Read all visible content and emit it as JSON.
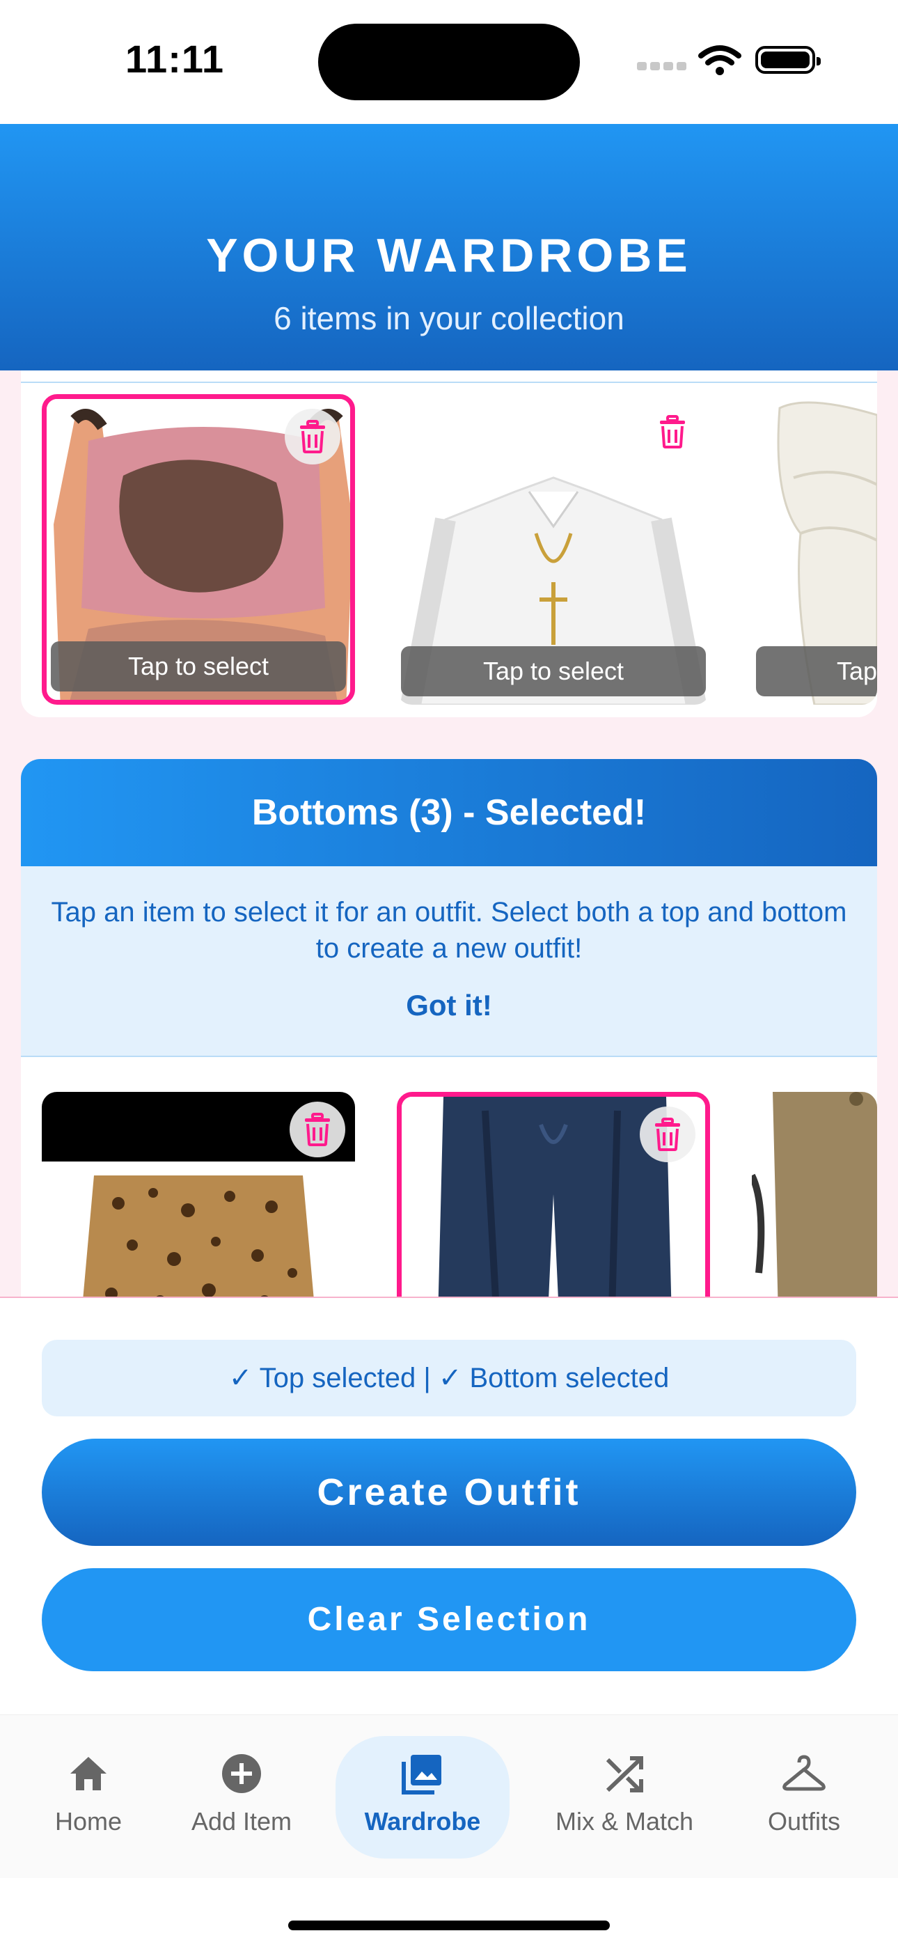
{
  "status_bar": {
    "time": "11:11"
  },
  "header": {
    "title": "YOUR WARDROBE",
    "subtitle": "6 items in your collection"
  },
  "tops": {
    "items": [
      {
        "label": "Tap to select",
        "selected": true
      },
      {
        "label": "Tap to select",
        "selected": false
      },
      {
        "label": "Tap",
        "selected": false
      }
    ]
  },
  "bottoms": {
    "heading": "Bottoms (3) - Selected!",
    "tip_text": "Tap an item to select it for an outfit. Select both a top and bottom to create a new outfit!",
    "tip_button": "Got it!"
  },
  "selection_status": "✓ Top selected | ✓ Bottom selected",
  "actions": {
    "create": "Create Outfit",
    "clear": "Clear Selection"
  },
  "tabs": [
    {
      "label": "Home",
      "icon": "home-icon"
    },
    {
      "label": "Add Item",
      "icon": "add-circle-icon"
    },
    {
      "label": "Wardrobe",
      "icon": "photo-library-icon",
      "active": true
    },
    {
      "label": "Mix & Match",
      "icon": "shuffle-icon"
    },
    {
      "label": "Outfits",
      "icon": "hanger-icon"
    }
  ],
  "colors": {
    "primary": "#2196f3",
    "primary_dark": "#1565c0",
    "accent_pink": "#ff1a8c",
    "background_pink": "#fdeef3"
  }
}
